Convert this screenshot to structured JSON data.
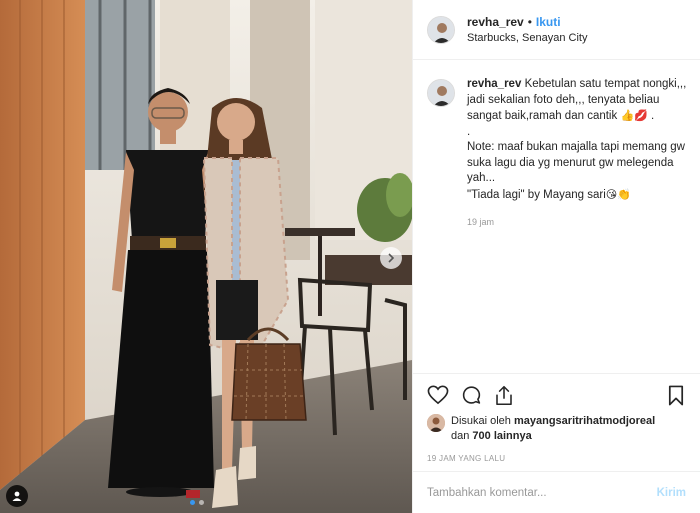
{
  "post": {
    "username": "revha_rev",
    "separator": "•",
    "follow_label": "Ikuti",
    "location": "Starbucks, Senayan City"
  },
  "caption": {
    "username": "revha_rev",
    "text_part1": "Kebetulan satu tempat nongki,,, jadi sekalian foto deh,,, tenyata beliau sangat baik,ramah dan cantik",
    "emoji1": "👍💋",
    "text_part2": " .\n.\nNote: maaf bukan majalla tapi memang gw suka lagu dia yg menurut gw melegenda yah...\n\"Tiada lagi\" by Mayang sari",
    "emoji2": "😘👏",
    "time": "19 jam"
  },
  "actions": {
    "like_icon": "heart-icon",
    "comment_icon": "comment-icon",
    "share_icon": "share-icon",
    "save_icon": "bookmark-icon"
  },
  "likes": {
    "prefix": "Disukai oleh ",
    "liker": "mayangsaritrihatmodjoreal",
    "connector": "dan",
    "others": "700 lainnya"
  },
  "timestamp": "19 JAM YANG LALU",
  "comment": {
    "placeholder": "Tambahkan komentar...",
    "post_label": "Kirim"
  },
  "carousel": {
    "slides": 2,
    "active": 0
  }
}
